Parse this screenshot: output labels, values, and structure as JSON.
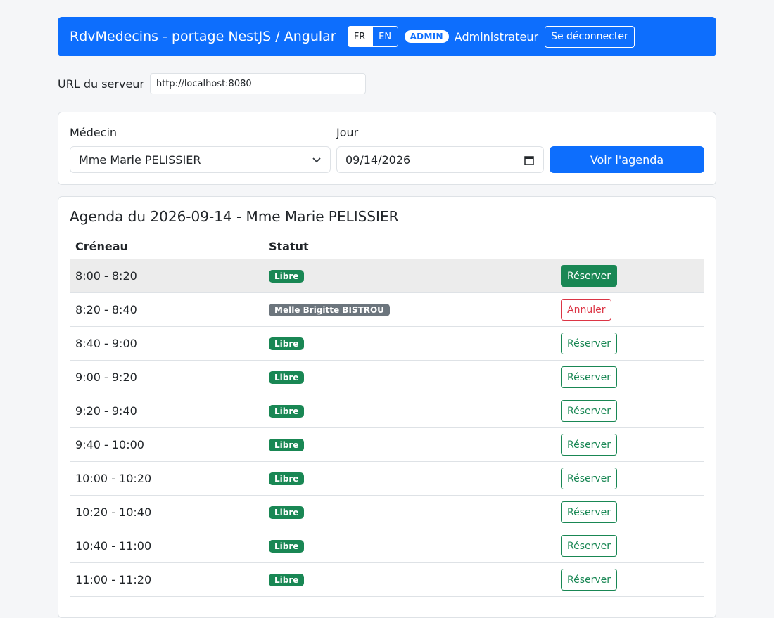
{
  "navbar": {
    "brand": "RdvMedecins - portage NestJS / Angular",
    "lang_fr": "FR",
    "lang_en": "EN",
    "role_badge": "ADMIN",
    "user_name": "Administrateur",
    "logout_label": "Se déconnecter"
  },
  "server": {
    "label": "URL du serveur",
    "value": "http://localhost:8080"
  },
  "filter": {
    "doctor_label": "Médecin",
    "doctor_selected": "Mme Marie PELISSIER",
    "day_label": "Jour",
    "day_value": "09/14/2026",
    "view_button": "Voir l'agenda"
  },
  "agenda": {
    "title": "Agenda du 2026-09-14 - Mme Marie PELISSIER",
    "col_slot": "Créneau",
    "col_status": "Statut",
    "rows": [
      {
        "slot": "8:00 - 8:20",
        "status": "Libre",
        "action": "Réserver"
      },
      {
        "slot": "8:20 - 8:40",
        "status": "Melle Brigitte BISTROU",
        "action": "Annuler"
      },
      {
        "slot": "8:40 - 9:00",
        "status": "Libre",
        "action": "Réserver"
      },
      {
        "slot": "9:00 - 9:20",
        "status": "Libre",
        "action": "Réserver"
      },
      {
        "slot": "9:20 - 9:40",
        "status": "Libre",
        "action": "Réserver"
      },
      {
        "slot": "9:40 - 10:00",
        "status": "Libre",
        "action": "Réserver"
      },
      {
        "slot": "10:00 - 10:20",
        "status": "Libre",
        "action": "Réserver"
      },
      {
        "slot": "10:20 - 10:40",
        "status": "Libre",
        "action": "Réserver"
      },
      {
        "slot": "10:40 - 11:00",
        "status": "Libre",
        "action": "Réserver"
      },
      {
        "slot": "11:00 - 11:20",
        "status": "Libre",
        "action": "Réserver"
      }
    ]
  },
  "colors": {
    "primary": "#0d6efd",
    "success": "#198754",
    "danger": "#dc3545",
    "secondary": "#6c757d"
  }
}
